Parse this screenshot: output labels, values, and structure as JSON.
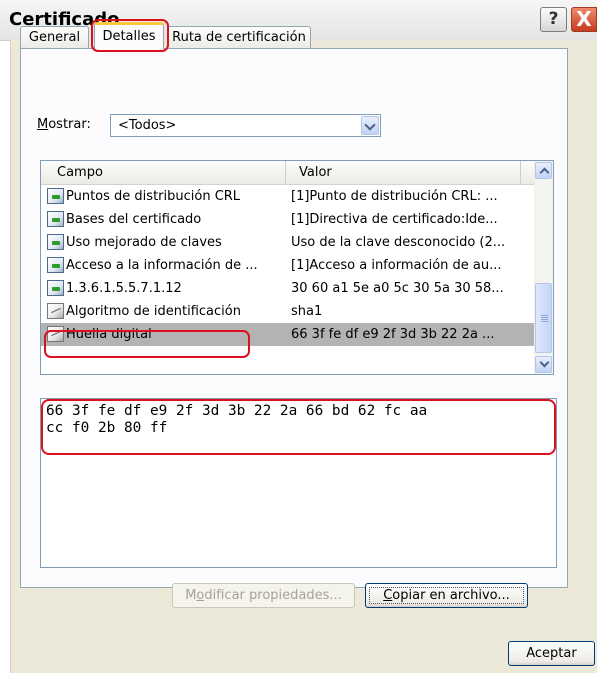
{
  "window": {
    "title": "Certificado",
    "help_label": "?",
    "close_label": "X"
  },
  "tabs": [
    {
      "label": "General"
    },
    {
      "label": "Detalles"
    },
    {
      "label": "Ruta de certificación"
    }
  ],
  "show": {
    "label_mnemonic": "M",
    "label_rest": "ostrar:",
    "value": "<Todos>"
  },
  "list": {
    "columns": [
      "Campo",
      "Valor"
    ],
    "rows": [
      {
        "campo": "Puntos de distribución CRL",
        "valor": "[1]Punto de distribución CRL: ...",
        "icon": "certificate-field-icon"
      },
      {
        "campo": "Bases del certificado",
        "valor": "[1]Directiva de certificado:Ide...",
        "icon": "certificate-field-icon"
      },
      {
        "campo": "Uso mejorado de claves",
        "valor": "Uso de la clave desconocido (2...",
        "icon": "certificate-field-icon"
      },
      {
        "campo": "Acceso a la información de ...",
        "valor": "[1]Acceso a información de au...",
        "icon": "certificate-field-icon"
      },
      {
        "campo": "1.3.6.1.5.5.7.1.12",
        "valor": "30 60 a1 5e a0 5c 30 5a 30 58...",
        "icon": "certificate-field-icon"
      },
      {
        "campo": "Algoritmo de identificación",
        "valor": "sha1",
        "icon": "property-field-icon"
      },
      {
        "campo": "Huella digital",
        "valor": "66 3f fe df e9 2f 3d 3b 22 2a ...",
        "icon": "property-field-icon",
        "selected": true
      }
    ]
  },
  "detail": {
    "value": "66 3f fe df e9 2f 3d 3b 22 2a 66 bd 62 fc aa\ncc f0 2b 80 ff"
  },
  "buttons": {
    "modificar_pre": "M",
    "modificar_mn": "o",
    "modificar_post": "dificar propiedades...",
    "copiar_mn": "C",
    "copiar_post": "opiar en archivo...",
    "aceptar": "Aceptar"
  },
  "colors": {
    "highlight": "#d9121b",
    "dialog_bg": "#ece9d8",
    "selected_row": "#b3b3b3"
  }
}
